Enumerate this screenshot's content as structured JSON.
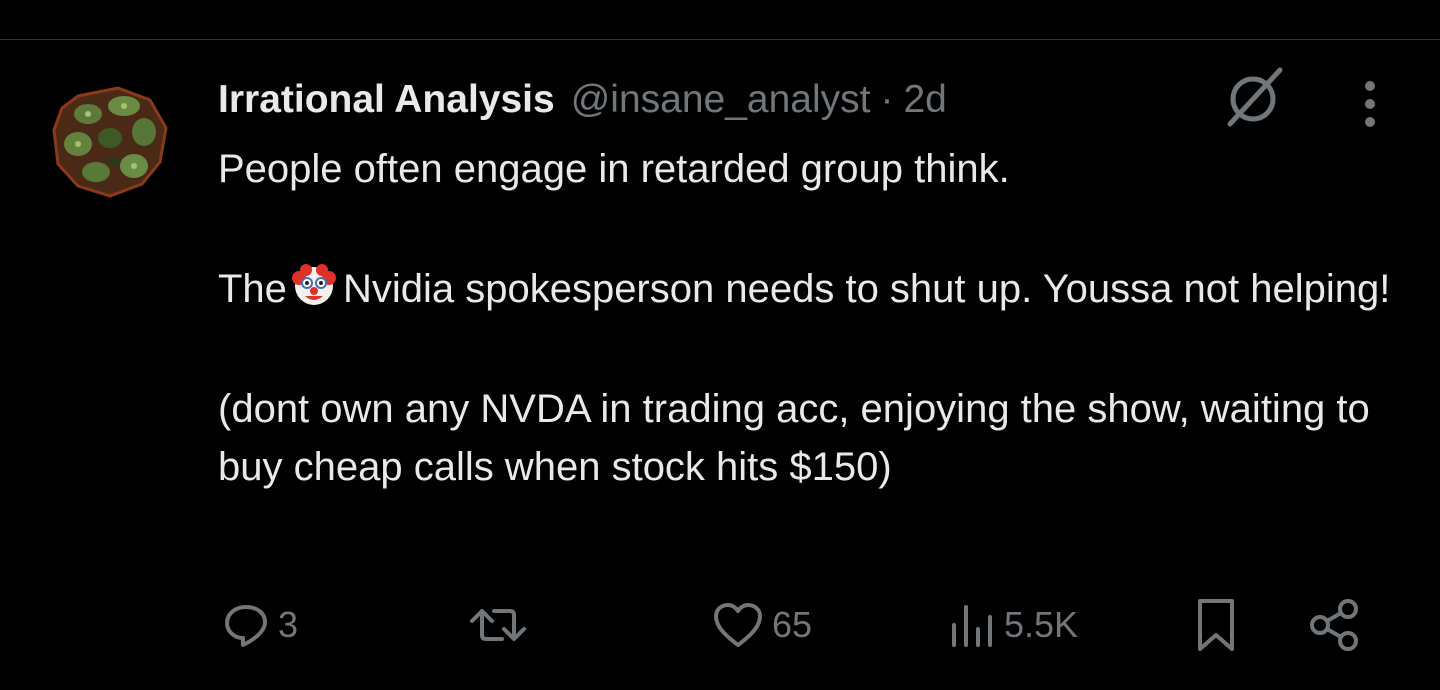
{
  "tweet": {
    "author": {
      "display_name": "Irrational Analysis",
      "handle": "@insane_analyst"
    },
    "separator": "·",
    "timestamp": "2d",
    "body": {
      "line1": "People often engage in retarded group think.",
      "line2_prefix": "The",
      "line2_emoji": "clown-face",
      "line2_suffix": "Nvidia spokesperson needs to shut up. Youssa not helping!",
      "line3": "(dont own any NVDA in trading acc, enjoying the show, waiting to buy cheap calls when stock hits $150)"
    },
    "actions": {
      "replies": "3",
      "retweets": "",
      "likes": "65",
      "views": "5.5K"
    }
  },
  "icons": {
    "grok": "grok-icon",
    "more": "more-vertical-icon",
    "reply": "reply-icon",
    "retweet": "retweet-icon",
    "like": "heart-icon",
    "views": "views-chart-icon",
    "bookmark": "bookmark-icon",
    "share": "share-icon"
  },
  "colors": {
    "background": "#000000",
    "text_primary": "#e7e9ea",
    "text_secondary": "#71767b",
    "divider": "#2f3336"
  }
}
